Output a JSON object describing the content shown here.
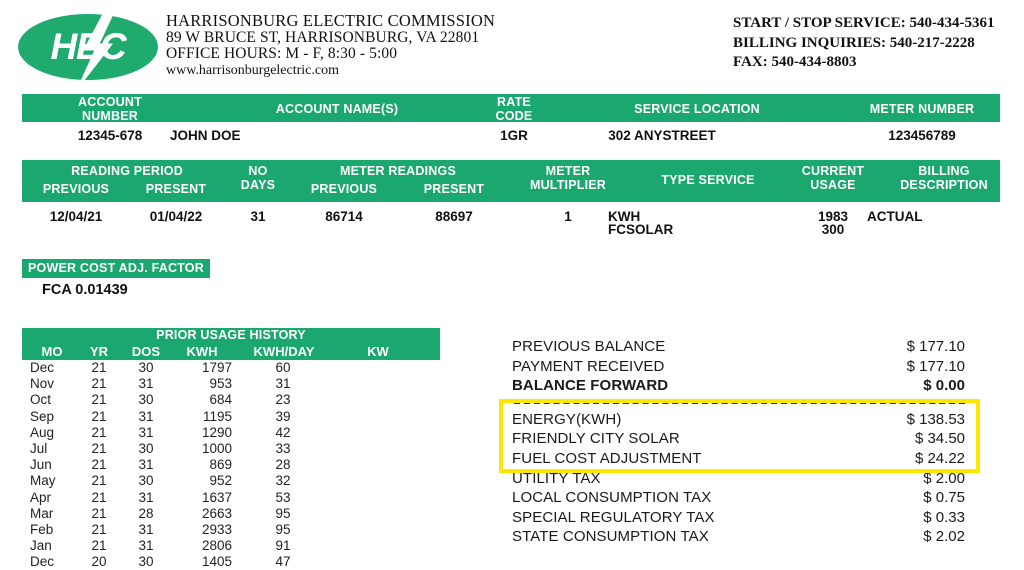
{
  "header": {
    "logo_text": "HEC",
    "logo_icon": "lightning-bolt-icon",
    "company_name": "HARRISONBURG ELECTRIC COMMISSION",
    "company_address": "89 W BRUCE ST, HARRISONBURG, VA 22801",
    "office_hours": "OFFICE HOURS: M - F, 8:30 - 5:00",
    "website": "www.harrisonburgelectric.com",
    "start_stop_service": "START / STOP SERVICE: 540-434-5361",
    "billing_inquiries": "BILLING INQUIRIES: 540-217-2228",
    "fax": "FAX: 540-434-8803"
  },
  "account_table": {
    "headers": {
      "account_number": "ACCOUNT\nNUMBER",
      "account_number_l1": "ACCOUNT",
      "account_number_l2": "NUMBER",
      "account_names": "ACCOUNT NAME(S)",
      "rate_code_l1": "RATE",
      "rate_code_l2": "CODE",
      "service_location": "SERVICE LOCATION",
      "meter_number": "METER NUMBER"
    },
    "values": {
      "account_number": "12345-678",
      "account_names": "JOHN DOE",
      "rate_code": "1GR",
      "service_location": "302 ANYSTREET",
      "meter_number": "123456789"
    }
  },
  "reading_table": {
    "headers": {
      "reading_period": "READING PERIOD",
      "previous": "PREVIOUS",
      "present": "PRESENT",
      "no_l1": "NO",
      "no_l2": "DAYS",
      "meter_readings": "METER READINGS",
      "mr_previous": "PREVIOUS",
      "mr_present": "PRESENT",
      "meter_mult_l1": "METER",
      "meter_mult_l2": "MULTIPLIER",
      "type_service": "TYPE  SERVICE",
      "current_l1": "CURRENT",
      "current_l2": "USAGE",
      "billing_l1": "BILLING",
      "billing_l2": "DESCRIPTION"
    },
    "values": {
      "previous_date": "12/04/21",
      "present_date": "01/04/22",
      "no_days": "31",
      "mr_previous": "86714",
      "mr_present": "88697",
      "meter_multiplier": "1",
      "type_service_1": "KWH",
      "type_service_2": "FCSOLAR",
      "current_usage_1": "1983",
      "current_usage_2": "300",
      "billing_description": "ACTUAL"
    }
  },
  "power_cost": {
    "label": "POWER COST ADJ. FACTOR",
    "value": "FCA  0.01439"
  },
  "usage_history": {
    "title": "PRIOR USAGE HISTORY",
    "columns": [
      "MO",
      "YR",
      "DOS",
      "KWH",
      "KWH/DAY",
      "KW"
    ],
    "rows": [
      {
        "mo": "Dec",
        "yr": "21",
        "dos": "30",
        "kwh": "1797",
        "kwh_day": "60",
        "kw": ""
      },
      {
        "mo": "Nov",
        "yr": "21",
        "dos": "31",
        "kwh": "953",
        "kwh_day": "31",
        "kw": ""
      },
      {
        "mo": "Oct",
        "yr": "21",
        "dos": "30",
        "kwh": "684",
        "kwh_day": "23",
        "kw": ""
      },
      {
        "mo": "Sep",
        "yr": "21",
        "dos": "31",
        "kwh": "1195",
        "kwh_day": "39",
        "kw": ""
      },
      {
        "mo": "Aug",
        "yr": "21",
        "dos": "31",
        "kwh": "1290",
        "kwh_day": "42",
        "kw": ""
      },
      {
        "mo": "Jul",
        "yr": "21",
        "dos": "30",
        "kwh": "1000",
        "kwh_day": "33",
        "kw": ""
      },
      {
        "mo": "Jun",
        "yr": "21",
        "dos": "31",
        "kwh": "869",
        "kwh_day": "28",
        "kw": ""
      },
      {
        "mo": "May",
        "yr": "21",
        "dos": "30",
        "kwh": "952",
        "kwh_day": "32",
        "kw": ""
      },
      {
        "mo": "Apr",
        "yr": "21",
        "dos": "31",
        "kwh": "1637",
        "kwh_day": "53",
        "kw": ""
      },
      {
        "mo": "Mar",
        "yr": "21",
        "dos": "28",
        "kwh": "2663",
        "kwh_day": "95",
        "kw": ""
      },
      {
        "mo": "Feb",
        "yr": "21",
        "dos": "31",
        "kwh": "2933",
        "kwh_day": "95",
        "kw": ""
      },
      {
        "mo": "Jan",
        "yr": "21",
        "dos": "31",
        "kwh": "2806",
        "kwh_day": "91",
        "kw": ""
      },
      {
        "mo": "Dec",
        "yr": "20",
        "dos": "30",
        "kwh": "1405",
        "kwh_day": "47",
        "kw": ""
      }
    ]
  },
  "charges": {
    "lines": [
      {
        "label": "PREVIOUS BALANCE",
        "amount": "$ 177.10",
        "bold": false,
        "highlighted": false
      },
      {
        "label": "PAYMENT RECEIVED",
        "amount": "$ 177.10",
        "bold": false,
        "highlighted": false
      },
      {
        "label": "BALANCE FORWARD",
        "amount": "$ 0.00",
        "bold": true,
        "highlighted": false
      },
      {
        "label": "ENERGY(KWH)",
        "amount": "$ 138.53",
        "bold": false,
        "highlighted": true
      },
      {
        "label": "FRIENDLY CITY SOLAR",
        "amount": "$ 34.50",
        "bold": false,
        "highlighted": true
      },
      {
        "label": "FUEL COST ADJUSTMENT",
        "amount": "$ 24.22",
        "bold": false,
        "highlighted": true
      },
      {
        "label": "UTILITY TAX",
        "amount": "$ 2.00",
        "bold": false,
        "highlighted": false
      },
      {
        "label": "LOCAL CONSUMPTION TAX",
        "amount": "$ 0.75",
        "bold": false,
        "highlighted": false
      },
      {
        "label": "SPECIAL REGULATORY TAX",
        "amount": "$ 0.33",
        "bold": false,
        "highlighted": false
      },
      {
        "label": "STATE CONSUMPTION TAX",
        "amount": "$ 2.02",
        "bold": false,
        "highlighted": false
      }
    ]
  },
  "colors": {
    "green": "#1aa86f",
    "highlight_yellow": "#ffe600",
    "text": "#1a1a1a"
  }
}
